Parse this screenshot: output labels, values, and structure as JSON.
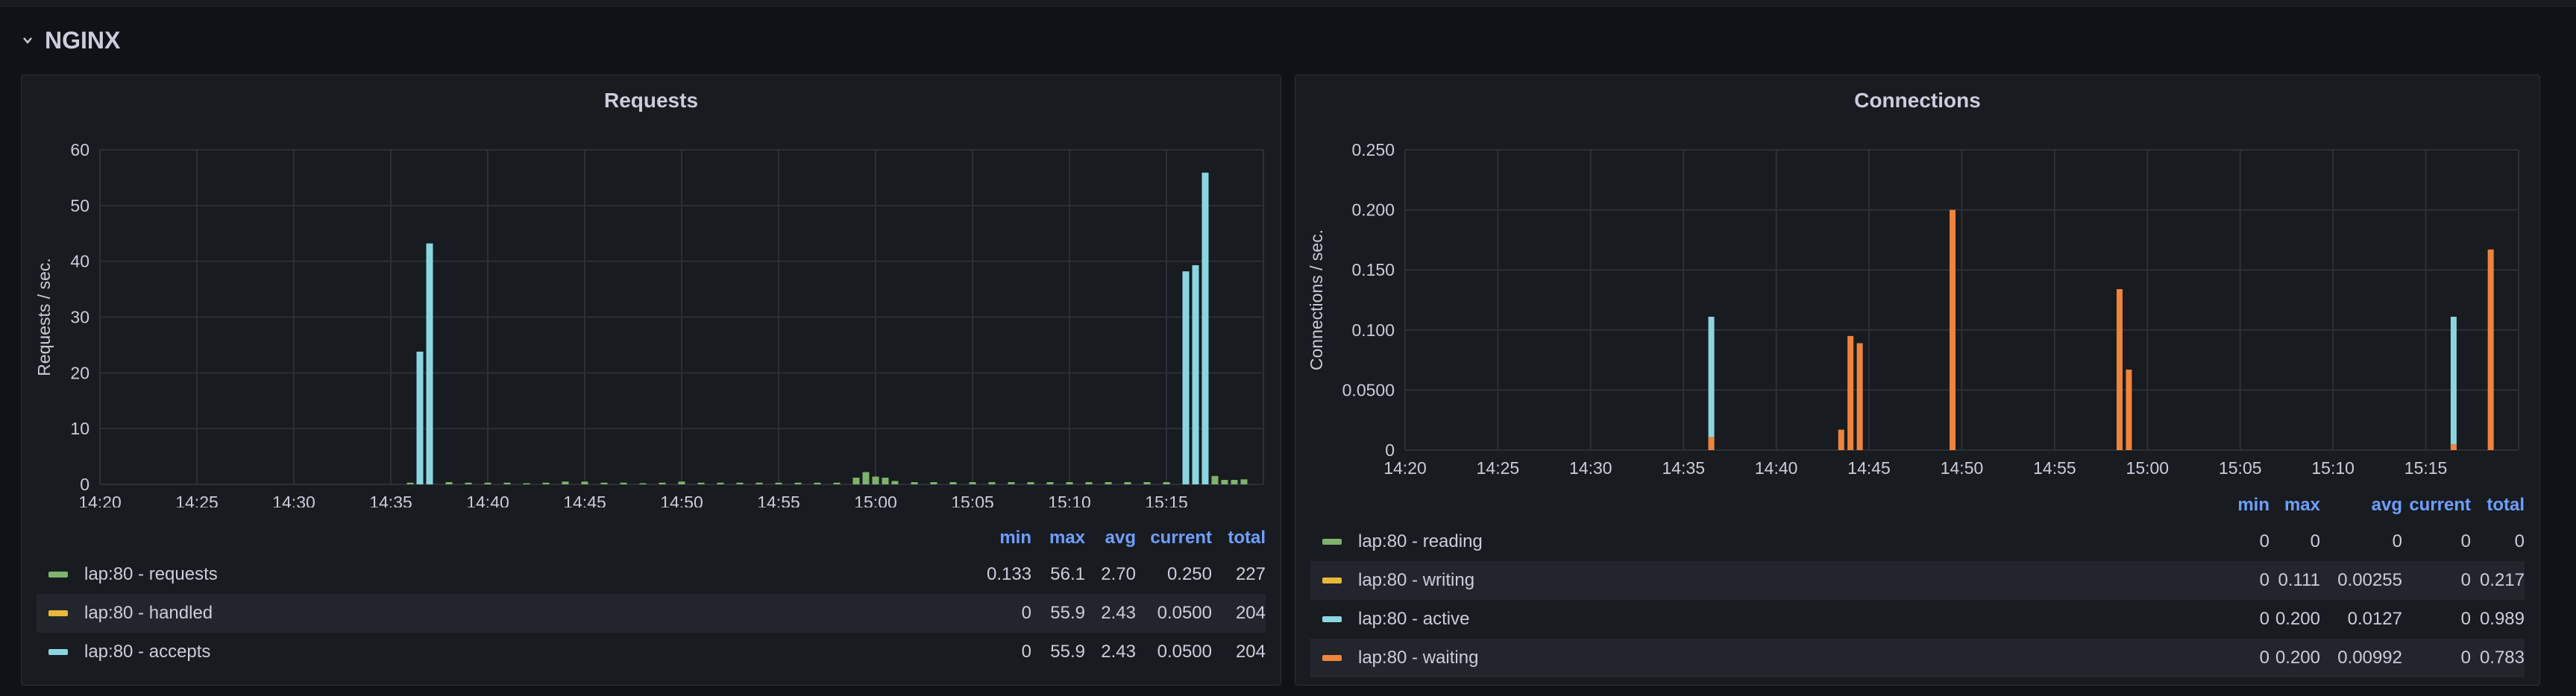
{
  "row": {
    "title": "NGINX",
    "chevron_icon": "chevron-down-icon"
  },
  "panels": [
    {
      "title": "Requests",
      "chart_data": {
        "type": "bar",
        "ylabel": "Requests / sec.",
        "ylim": [
          0,
          60
        ],
        "yticks": [
          "0",
          "10",
          "20",
          "30",
          "40",
          "50",
          "60"
        ],
        "xlim": [
          "14:20",
          "15:20"
        ],
        "xticks": [
          "14:20",
          "14:25",
          "14:30",
          "14:35",
          "14:40",
          "14:45",
          "14:50",
          "14:55",
          "15:00",
          "15:05",
          "15:10",
          "15:15"
        ],
        "grid": true,
        "series": [
          {
            "name": "lap:80 - requests",
            "color": "#7eb26d",
            "points": [
              [
                "14:36:00",
                0.3
              ],
              [
                "14:37:00",
                0.4
              ],
              [
                "14:38:00",
                0.4
              ],
              [
                "14:39:00",
                0.3
              ],
              [
                "14:40:00",
                0.3
              ],
              [
                "14:41:00",
                0.3
              ],
              [
                "14:42:00",
                0.2
              ],
              [
                "14:43:00",
                0.3
              ],
              [
                "14:44:00",
                0.5
              ],
              [
                "14:45:00",
                0.5
              ],
              [
                "14:46:00",
                0.3
              ],
              [
                "14:47:00",
                0.3
              ],
              [
                "14:48:00",
                0.2
              ],
              [
                "14:49:00",
                0.3
              ],
              [
                "14:50:00",
                0.5
              ],
              [
                "14:51:00",
                0.3
              ],
              [
                "14:52:00",
                0.3
              ],
              [
                "14:53:00",
                0.3
              ],
              [
                "14:54:00",
                0.3
              ],
              [
                "14:55:00",
                0.3
              ],
              [
                "14:56:00",
                0.3
              ],
              [
                "14:57:00",
                0.3
              ],
              [
                "14:58:00",
                0.3
              ],
              [
                "14:59:00",
                1.2
              ],
              [
                "14:59:30",
                2.2
              ],
              [
                "15:00:00",
                1.4
              ],
              [
                "15:00:30",
                1.2
              ],
              [
                "15:01:00",
                0.6
              ],
              [
                "15:02:00",
                0.4
              ],
              [
                "15:03:00",
                0.4
              ],
              [
                "15:04:00",
                0.4
              ],
              [
                "15:05:00",
                0.4
              ],
              [
                "15:06:00",
                0.4
              ],
              [
                "15:07:00",
                0.4
              ],
              [
                "15:08:00",
                0.4
              ],
              [
                "15:09:00",
                0.4
              ],
              [
                "15:10:00",
                0.4
              ],
              [
                "15:11:00",
                0.4
              ],
              [
                "15:12:00",
                0.4
              ],
              [
                "15:13:00",
                0.4
              ],
              [
                "15:14:00",
                0.4
              ],
              [
                "15:15:00",
                0.4
              ],
              [
                "15:17:30",
                1.5
              ],
              [
                "15:18:00",
                0.8
              ],
              [
                "15:18:30",
                0.8
              ],
              [
                "15:19:00",
                0.9
              ]
            ]
          },
          {
            "name": "lap:80 - accepts",
            "color": "#8ad6e0",
            "points": [
              [
                "14:36:30",
                23.8
              ],
              [
                "14:37:00",
                43.2
              ],
              [
                "15:16:00",
                38.2
              ],
              [
                "15:16:30",
                39.3
              ],
              [
                "15:17:00",
                55.9
              ]
            ]
          }
        ]
      },
      "legend": {
        "headers": {
          "min": "min",
          "max": "max",
          "avg": "avg",
          "current": "current",
          "total": "total"
        },
        "rows": [
          {
            "name": "lap:80 - requests",
            "color": "#7eb26d",
            "min": "0.133",
            "max": "56.1",
            "avg": "2.70",
            "current": "0.250",
            "total": "227"
          },
          {
            "name": "lap:80 - handled",
            "color": "#eab839",
            "min": "0",
            "max": "55.9",
            "avg": "2.43",
            "current": "0.0500",
            "total": "204"
          },
          {
            "name": "lap:80 - accepts",
            "color": "#8ad6e0",
            "min": "0",
            "max": "55.9",
            "avg": "2.43",
            "current": "0.0500",
            "total": "204"
          }
        ]
      }
    },
    {
      "title": "Connections",
      "chart_data": {
        "type": "bar",
        "ylabel": "Connections / sec.",
        "ylim": [
          0,
          0.25
        ],
        "yticks": [
          "0",
          "0.0500",
          "0.100",
          "0.150",
          "0.200",
          "0.250"
        ],
        "xlim": [
          "14:20",
          "15:20"
        ],
        "xticks": [
          "14:20",
          "14:25",
          "14:30",
          "14:35",
          "14:40",
          "14:45",
          "14:50",
          "14:55",
          "15:00",
          "15:05",
          "15:10",
          "15:15"
        ],
        "grid": true,
        "series": [
          {
            "name": "lap:80 - active",
            "color": "#8ad6e0",
            "points": [
              [
                "14:36:30",
                0.111
              ],
              [
                "15:16:30",
                0.111
              ]
            ]
          },
          {
            "name": "lap:80 - waiting",
            "color": "#ef843c",
            "points": [
              [
                "14:36:30",
                0.011
              ],
              [
                "14:43:30",
                0.017
              ],
              [
                "14:44:00",
                0.095
              ],
              [
                "14:44:30",
                0.089
              ],
              [
                "14:49:30",
                0.2
              ],
              [
                "14:58:30",
                0.134
              ],
              [
                "14:59:00",
                0.067
              ],
              [
                "15:16:30",
                0.005
              ],
              [
                "15:18:30",
                0.167
              ]
            ]
          }
        ]
      },
      "legend": {
        "headers": {
          "min": "min",
          "max": "max",
          "avg": "avg",
          "current": "current",
          "total": "total"
        },
        "rows": [
          {
            "name": "lap:80 - reading",
            "color": "#7eb26d",
            "min": "0",
            "max": "0",
            "avg": "0",
            "current": "0",
            "total": "0"
          },
          {
            "name": "lap:80 - writing",
            "color": "#eab839",
            "min": "0",
            "max": "0.111",
            "avg": "0.00255",
            "current": "0",
            "total": "0.217"
          },
          {
            "name": "lap:80 - active",
            "color": "#8ad6e0",
            "min": "0",
            "max": "0.200",
            "avg": "0.0127",
            "current": "0",
            "total": "0.989"
          },
          {
            "name": "lap:80 - waiting",
            "color": "#ef843c",
            "min": "0",
            "max": "0.200",
            "avg": "0.00992",
            "current": "0",
            "total": "0.783"
          }
        ]
      }
    }
  ]
}
